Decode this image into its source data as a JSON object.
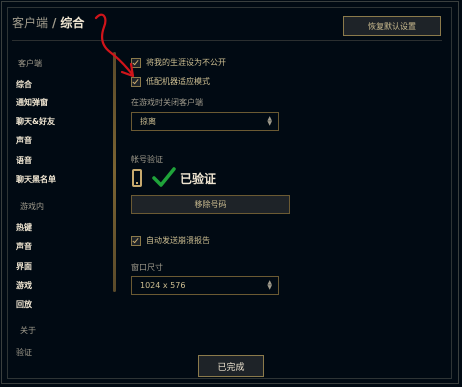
{
  "header": {
    "crumb": "客户端",
    "separator": "/",
    "current": "综合",
    "restore_defaults": "恢复默认设置"
  },
  "sidebar": {
    "client_header": "客户端",
    "client_items": [
      "综合",
      "通知弹窗",
      "聊天&好友",
      "声音",
      "语音",
      "聊天黑名单"
    ],
    "ingame_header": "游戏内",
    "ingame_items": [
      "热键",
      "声音",
      "界面",
      "游戏",
      "回放"
    ],
    "about_header": "关于",
    "about_items": [
      "验证"
    ]
  },
  "settings": {
    "profile_private": "将我的生涯设为不公开",
    "low_spec_mode": "低配机器适应模式",
    "close_client_label": "在游戏时关闭客户端",
    "close_client_value": "掠离",
    "account_verify_label": "帐号验证",
    "verified_text": "已验证",
    "remove_number": "移除号码",
    "auto_crash_report": "自动发送崩溃报告",
    "window_size_label": "窗口尺寸",
    "window_size_value": "1024 x 576"
  },
  "footer": {
    "done": "已完成"
  },
  "colors": {
    "gold": "#c8aa6e",
    "text": "#cdbe91",
    "annotation_red": "#d0141a",
    "check_green": "#1fa33a"
  },
  "icons": [
    "phone-icon",
    "checkmark-icon",
    "updown-arrow-icon"
  ]
}
